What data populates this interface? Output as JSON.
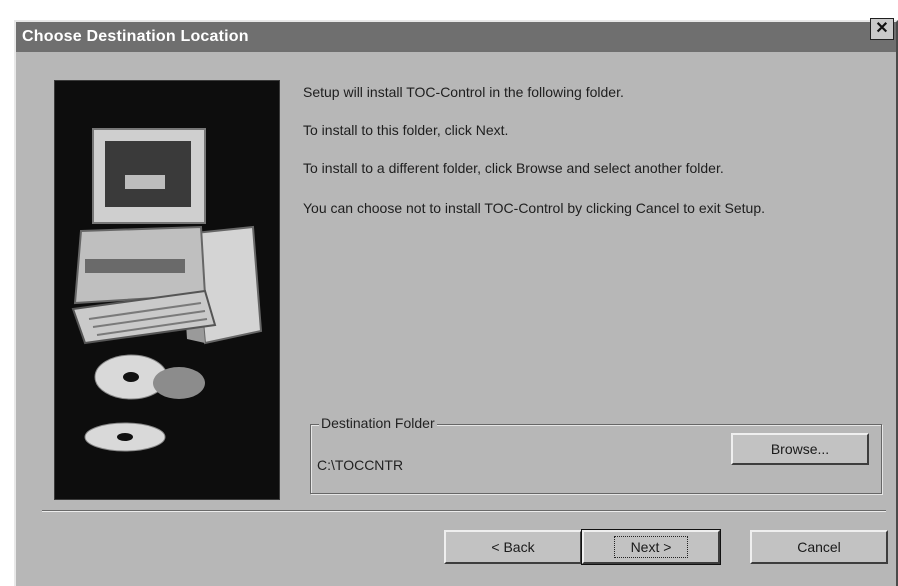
{
  "window": {
    "title": "Choose Destination Location",
    "close_symbol": "✕"
  },
  "messages": [
    "Setup will install TOC-Control in the following folder.",
    "To install to this folder, click Next.",
    "To install to a different folder, click Browse and select another folder.",
    "You can choose not to install TOC-Control by clicking Cancel to exit Setup."
  ],
  "destination": {
    "group_label": "Destination Folder",
    "path": "C:\\TOCCNTR",
    "browse_label": "Browse..."
  },
  "buttons": {
    "back_label": "< Back",
    "next_label": "Next >",
    "cancel_label": "Cancel"
  },
  "illustration": {
    "icon": "computer-with-cds-icon"
  }
}
